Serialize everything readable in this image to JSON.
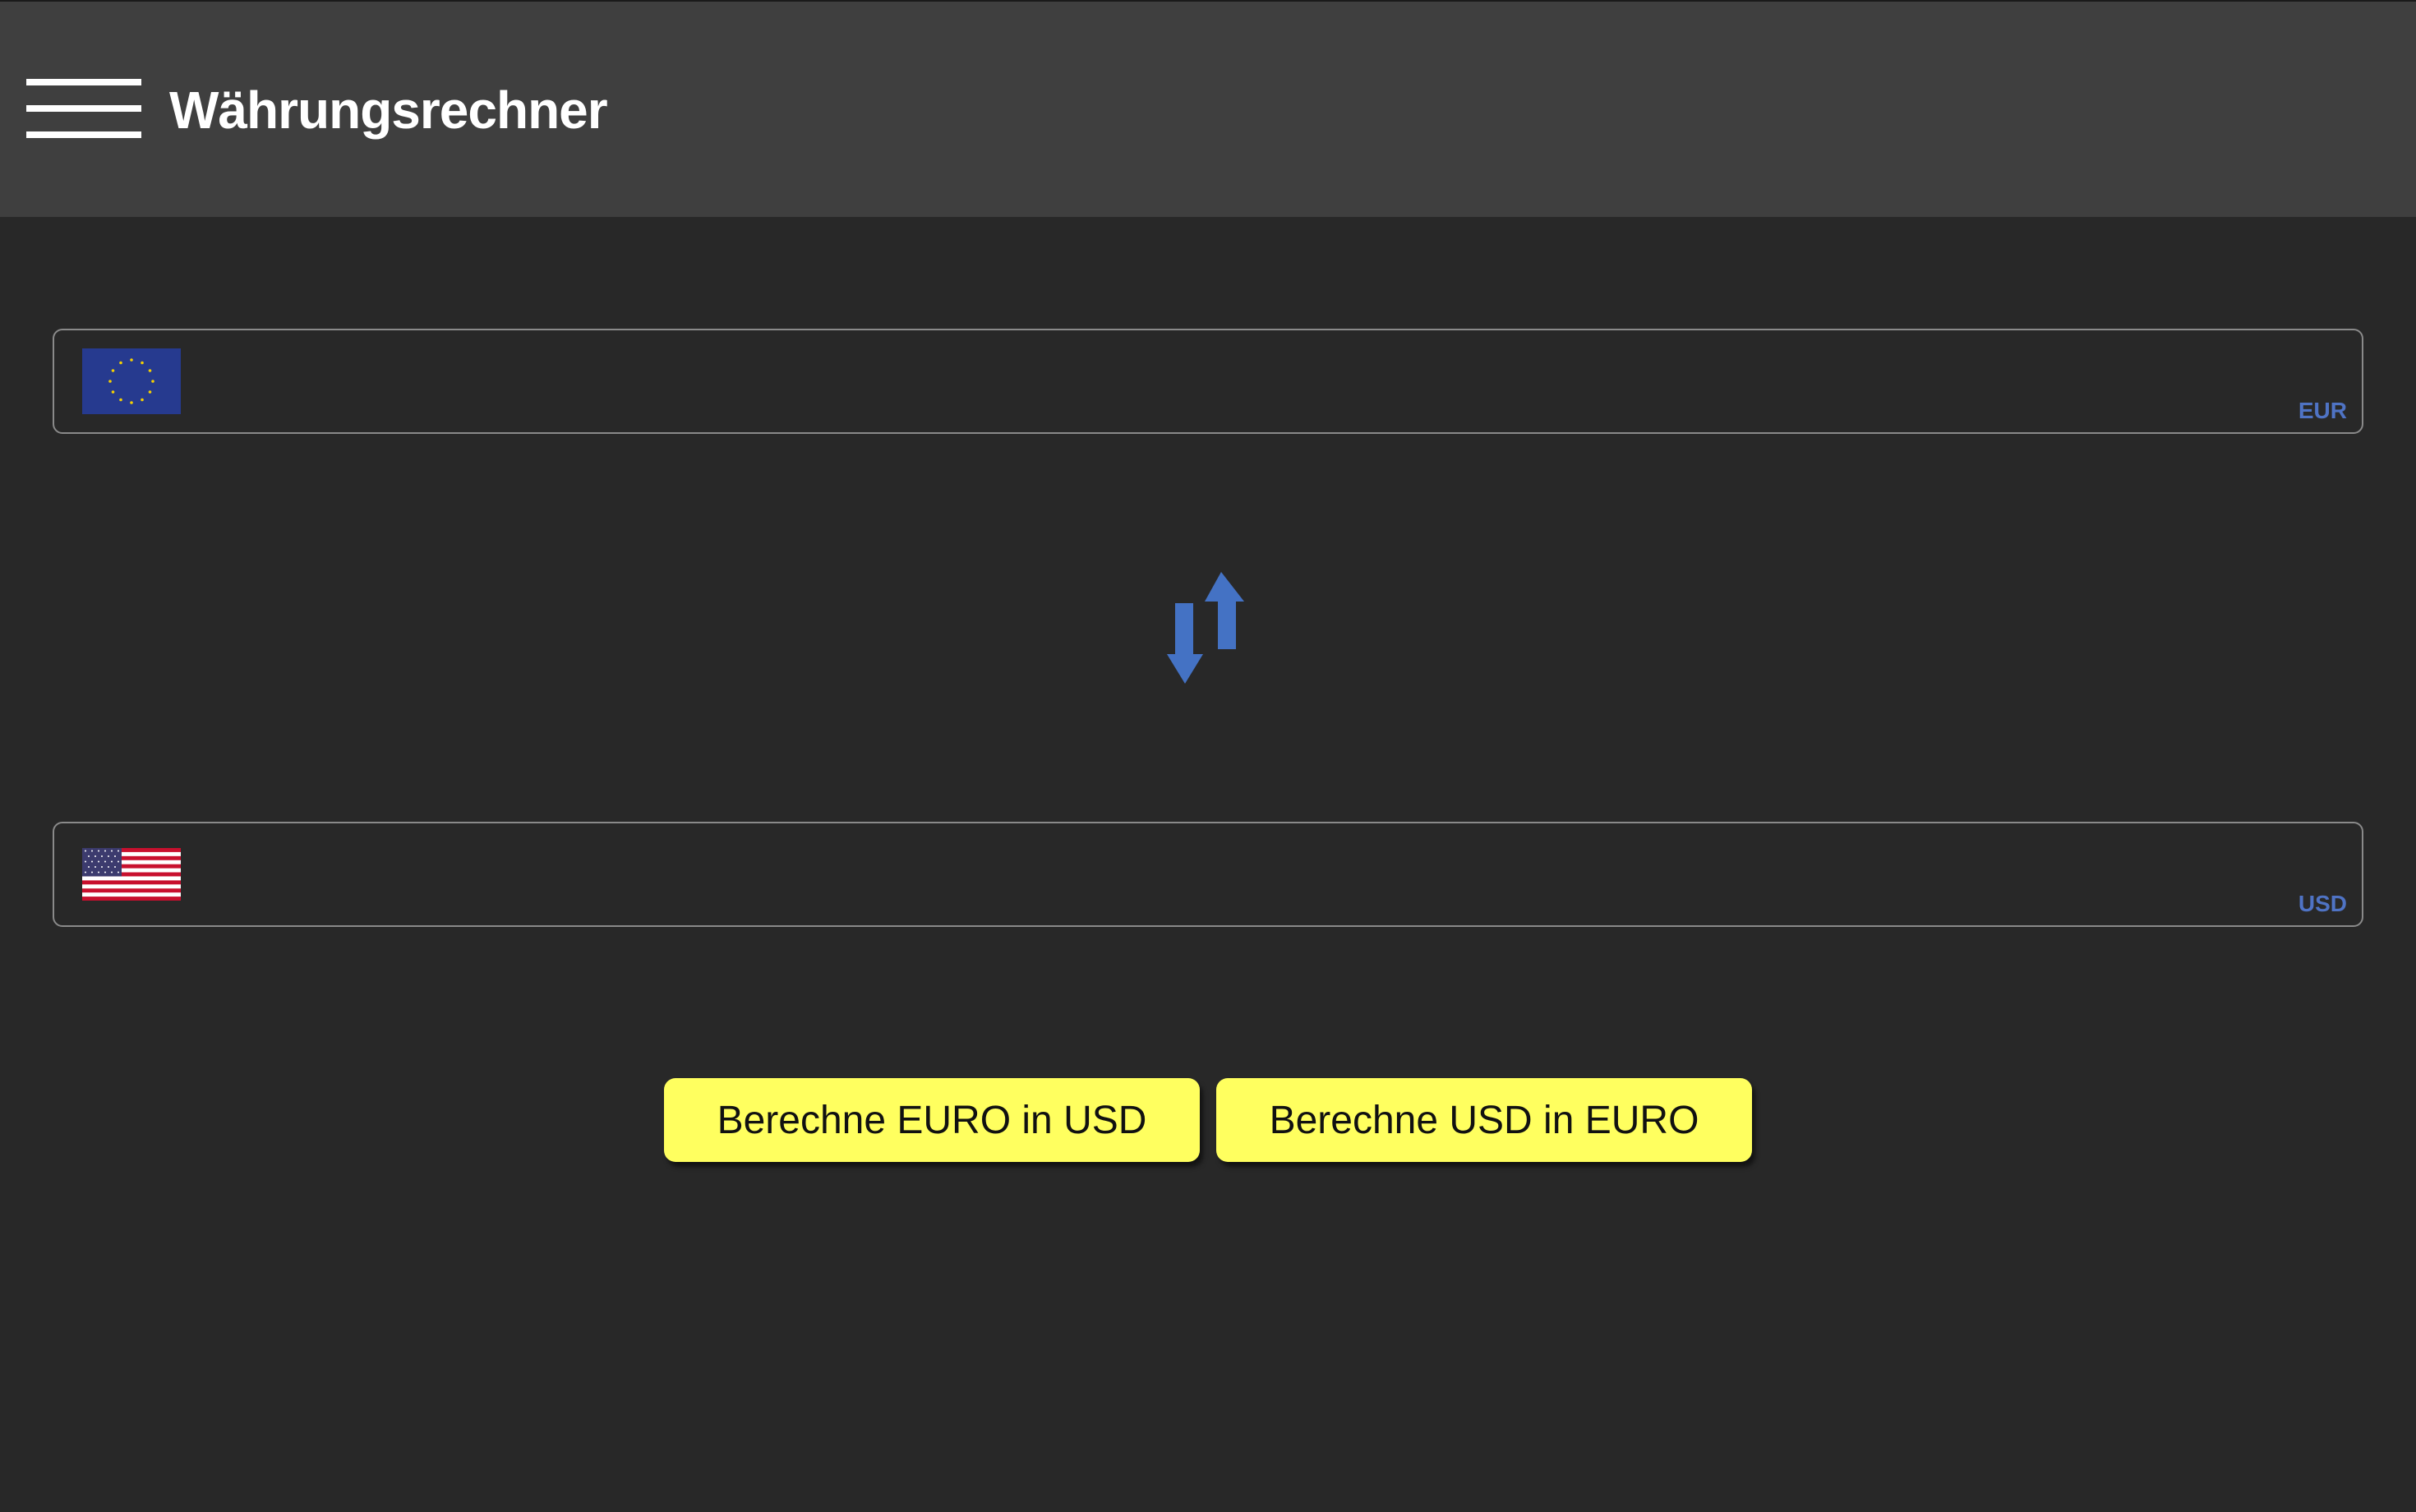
{
  "header": {
    "title": "Währungsrechner",
    "menu_icon": "hamburger-menu-icon"
  },
  "fields": {
    "eur": {
      "code": "EUR",
      "flag_icon": "eu-flag-icon",
      "value": "",
      "placeholder": ""
    },
    "usd": {
      "code": "USD",
      "flag_icon": "us-flag-icon",
      "value": "",
      "placeholder": ""
    }
  },
  "swap": {
    "icon": "swap-vertical-arrows-icon",
    "color": "#4472c4"
  },
  "actions": {
    "eur_to_usd_label": "Berechne EURO in USD",
    "usd_to_eur_label": "Berechne USD in EURO"
  },
  "colors": {
    "background": "#282828",
    "header": "#3f3f3f",
    "accent": "#4f73c4",
    "button": "#ffff5f"
  }
}
